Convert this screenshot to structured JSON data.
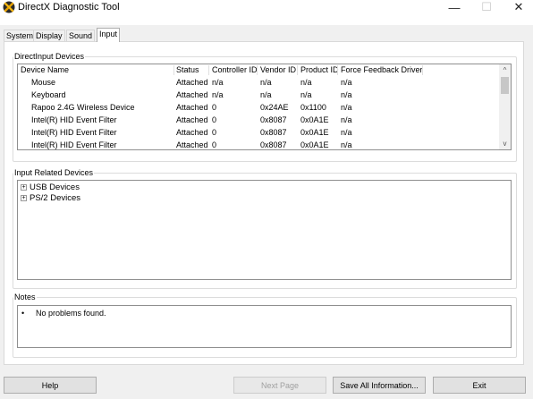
{
  "window": {
    "title": "DirectX Diagnostic Tool",
    "minimize_glyph": "—",
    "maximize_glyph": "☐",
    "close_glyph": "✕"
  },
  "tabs": [
    {
      "label": "System",
      "active": false
    },
    {
      "label": "Display",
      "active": false
    },
    {
      "label": "Sound",
      "active": false
    },
    {
      "label": "Input",
      "active": true
    }
  ],
  "direct_input": {
    "group_label": "DirectInput Devices",
    "columns": [
      "Device Name",
      "Status",
      "Controller ID",
      "Vendor ID",
      "Product ID",
      "Force Feedback Driver"
    ],
    "rows": [
      [
        "Mouse",
        "Attached",
        "n/a",
        "n/a",
        "n/a",
        "n/a"
      ],
      [
        "Keyboard",
        "Attached",
        "n/a",
        "n/a",
        "n/a",
        "n/a"
      ],
      [
        "Rapoo 2.4G Wireless Device",
        "Attached",
        "0",
        "0x24AE",
        "0x1100",
        "n/a"
      ],
      [
        "Intel(R) HID Event Filter",
        "Attached",
        "0",
        "0x8087",
        "0x0A1E",
        "n/a"
      ],
      [
        "Intel(R) HID Event Filter",
        "Attached",
        "0",
        "0x8087",
        "0x0A1E",
        "n/a"
      ],
      [
        "Intel(R) HID Event Filter",
        "Attached",
        "0",
        "0x8087",
        "0x0A1E",
        "n/a"
      ]
    ],
    "scroll_up_glyph": "^",
    "scroll_down_glyph": "v"
  },
  "input_related": {
    "group_label": "Input Related Devices",
    "items": [
      {
        "label": "USB Devices",
        "expander": "+"
      },
      {
        "label": "PS/2 Devices",
        "expander": "+"
      }
    ]
  },
  "notes": {
    "group_label": "Notes",
    "bullet": "•",
    "lines": [
      "No problems found."
    ]
  },
  "buttons": {
    "help": "Help",
    "next_page": "Next Page",
    "save_all": "Save All Information...",
    "exit": "Exit"
  },
  "colors": {
    "window_bg": "#f0f0f0",
    "panel_bg": "#ffffff",
    "button_bg": "#e1e1e1",
    "disabled_text": "#a0a0a0"
  },
  "icons": {
    "app": "directx-x-icon",
    "expander": "plus-box-icon"
  }
}
